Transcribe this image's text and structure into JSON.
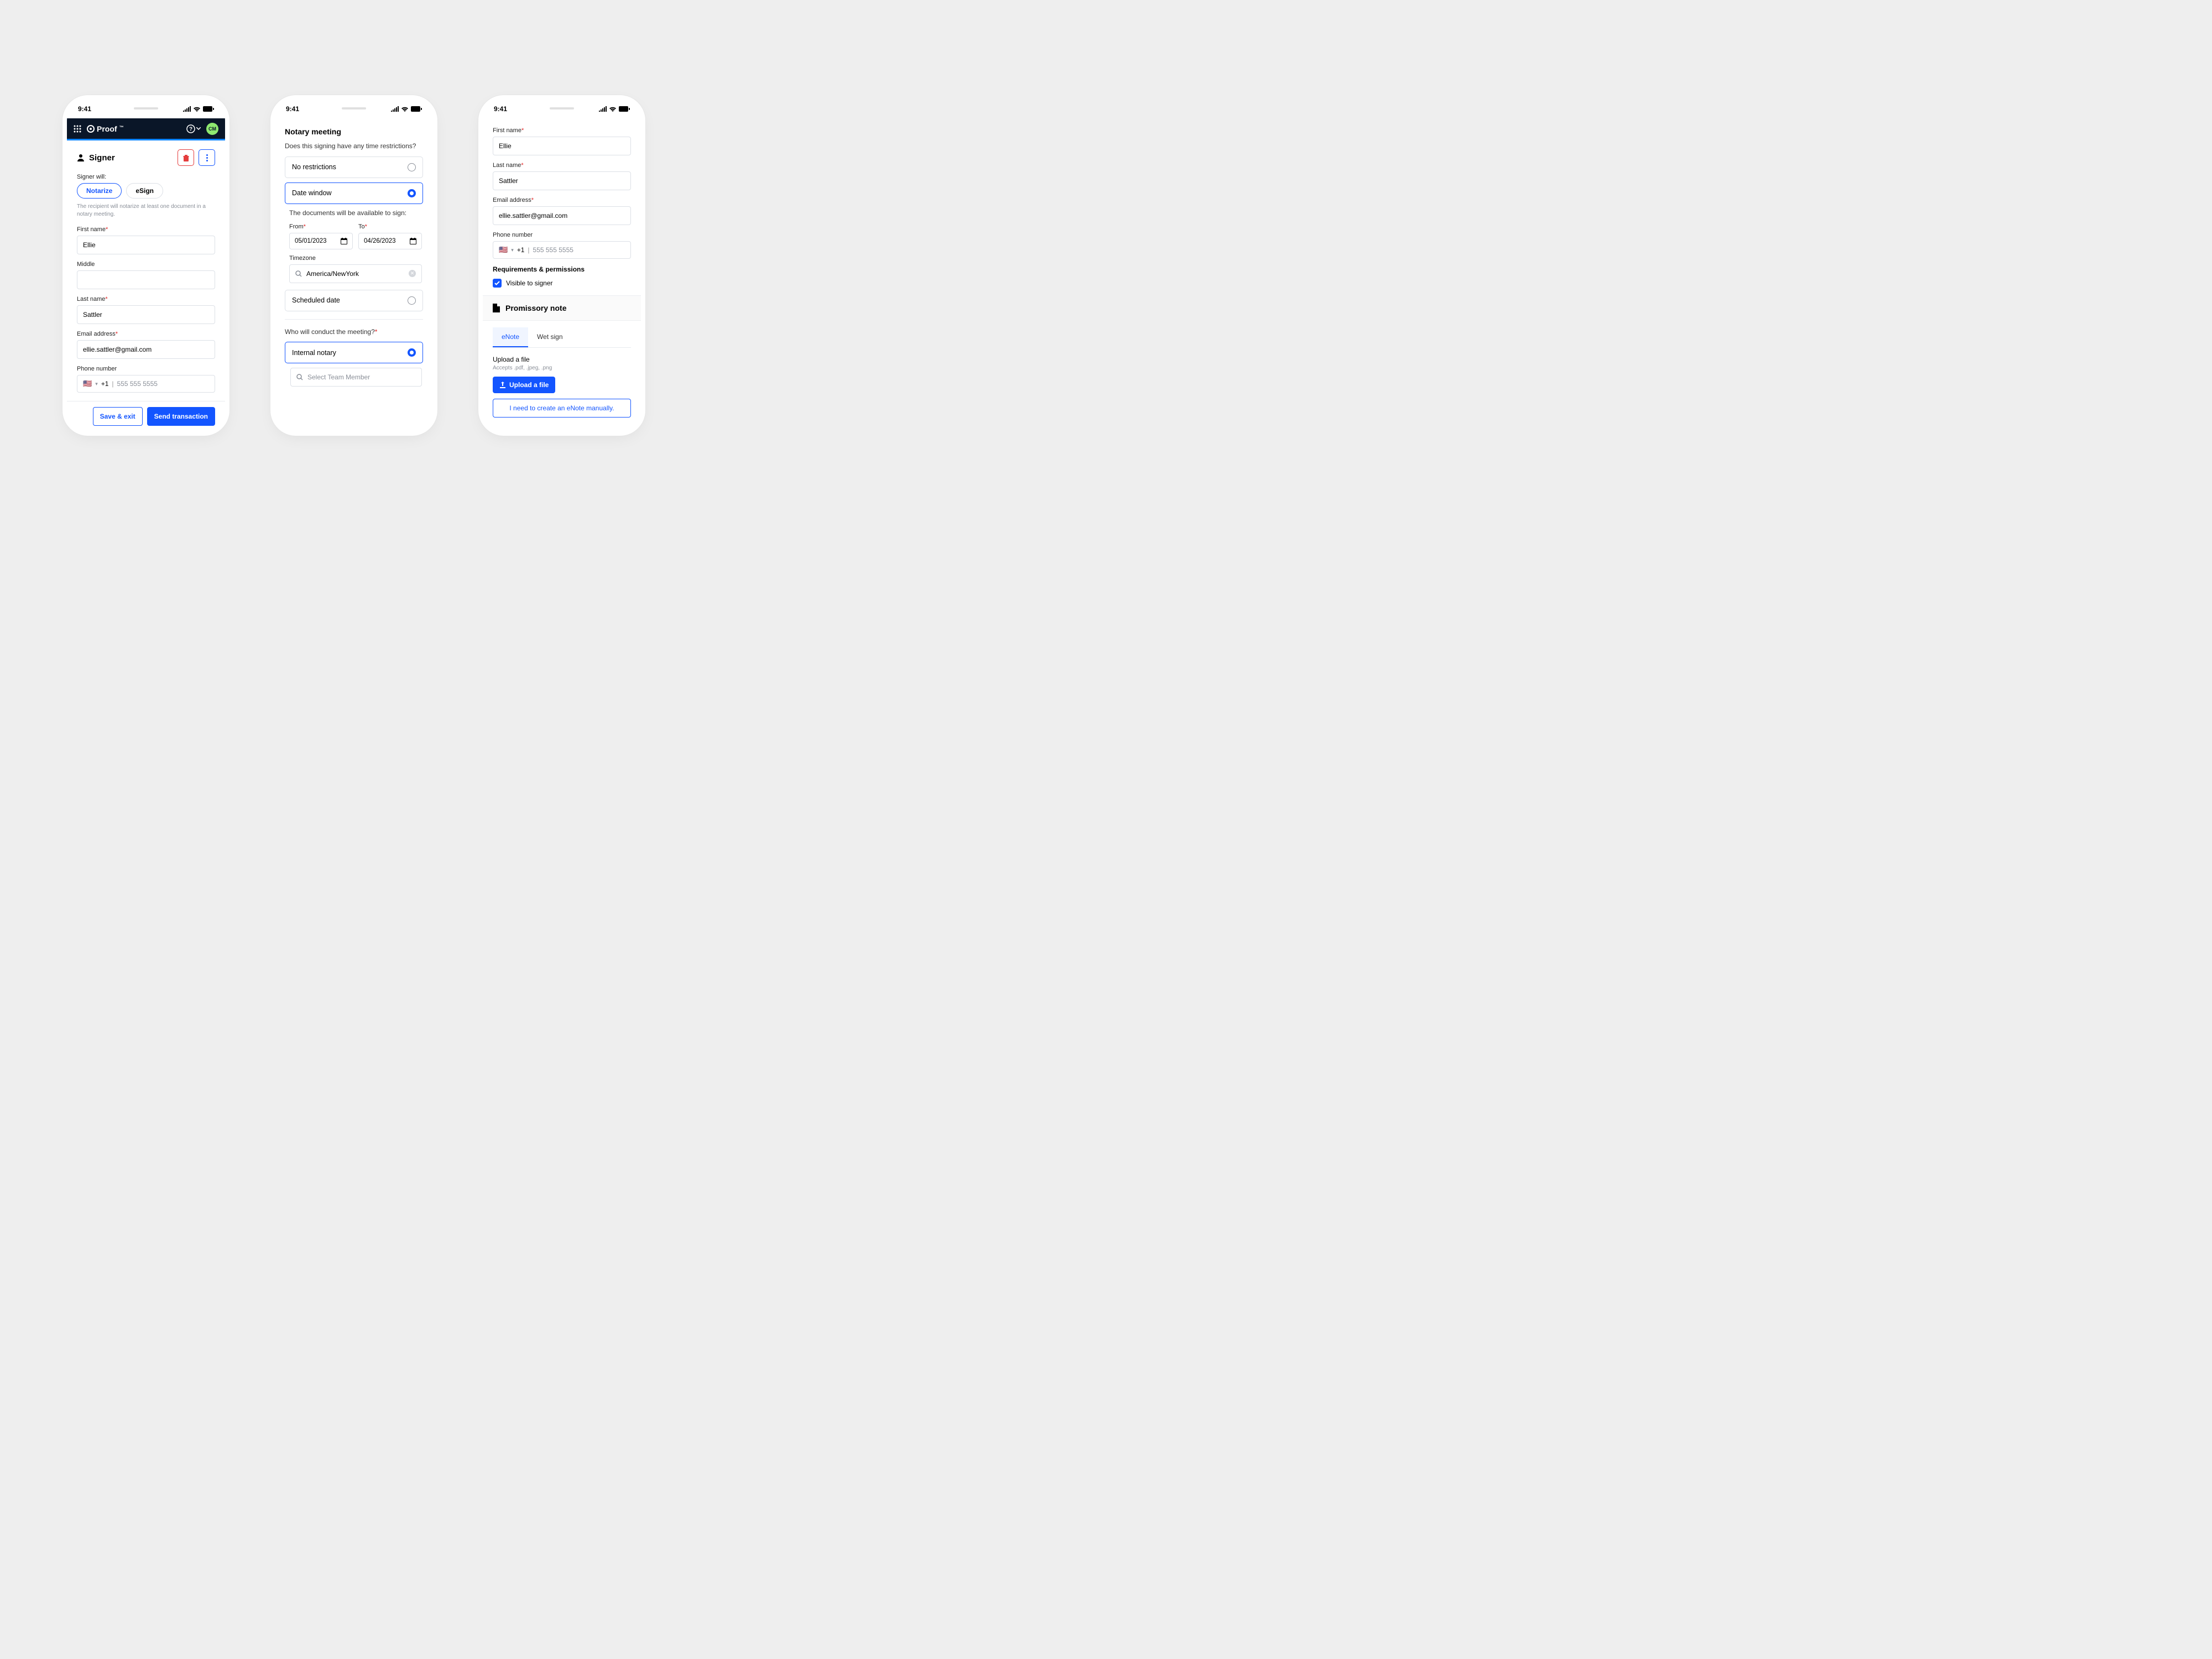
{
  "status": {
    "time": "9:41"
  },
  "phone1": {
    "brand": "Proof",
    "avatar_initials": "CM",
    "signer_title": "Signer",
    "signer_will_label": "Signer will:",
    "options": {
      "notarize": "Notarize",
      "esign": "eSign"
    },
    "hint": "The recipient will notarize at least one document in a notary meeting.",
    "labels": {
      "first_name": "First name",
      "middle": "Middle",
      "last_name": "Last name",
      "email": "Email address",
      "phone": "Phone number"
    },
    "values": {
      "first_name": "Ellie",
      "last_name": "Sattler",
      "email": "ellie.sattler@gmail.com",
      "phone_prefix": "+1",
      "phone_placeholder": "555  555  5555"
    },
    "footer": {
      "save_exit": "Save & exit",
      "send": "Send transaction"
    }
  },
  "phone2": {
    "title": "Notary meeting",
    "question": "Does this signing have any time restrictions?",
    "opts": {
      "no_restrictions": "No restrictions",
      "date_window": "Date window",
      "scheduled": "Scheduled date"
    },
    "window_text": "The documents will be available to sign:",
    "from_label": "From",
    "to_label": "To",
    "from_value": "05/01/2023",
    "to_value": "04/26/2023",
    "tz_label": "Timezone",
    "tz_value": "America/NewYork",
    "conduct_q": "Who will conduct the meeting?",
    "internal": "Internal notary",
    "select_member": "Select Team Member"
  },
  "phone3": {
    "labels": {
      "first_name": "First name",
      "last_name": "Last name",
      "email": "Email address",
      "phone": "Phone number",
      "req_perms": "Requirements & permissions",
      "visible": "Visible to signer"
    },
    "values": {
      "first_name": "Ellie",
      "last_name": "Sattler",
      "email": "ellie.sattler@gmail.com",
      "phone_prefix": "+1",
      "phone_placeholder": "555  555  5555"
    },
    "promissory": "Promissory note",
    "tabs": {
      "enote": "eNote",
      "wet": "Wet sign"
    },
    "upload_label": "Upload a file",
    "upload_hint": "Accepts .pdf, .jpeg, .png",
    "upload_btn": "Upload a file",
    "manual_link": "I need to create an eNote manually."
  }
}
